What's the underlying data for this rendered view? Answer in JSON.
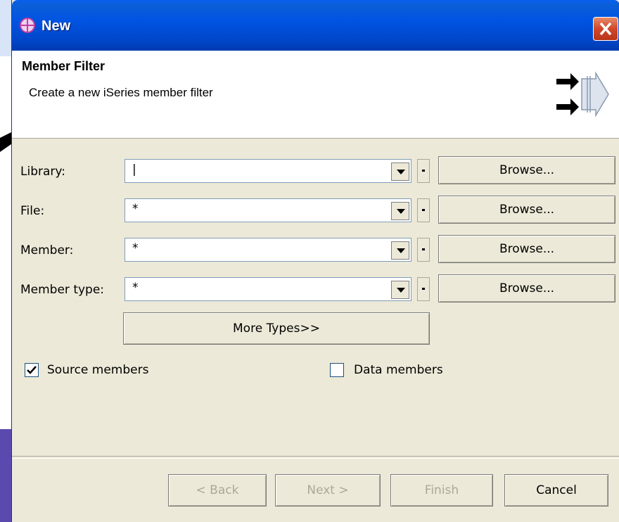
{
  "window": {
    "title": "New"
  },
  "header": {
    "title": "Member Filter",
    "description": "Create a new iSeries member filter"
  },
  "form": {
    "rows": [
      {
        "label": "Library:",
        "value": "|",
        "browse": "Browse..."
      },
      {
        "label": "File:",
        "value": "*",
        "browse": "Browse..."
      },
      {
        "label": "Member:",
        "value": "*",
        "browse": "Browse..."
      },
      {
        "label": "Member type:",
        "value": "*",
        "browse": "Browse..."
      }
    ],
    "more_types": "More Types>>",
    "source_members": {
      "label": "Source members",
      "checked": true
    },
    "data_members": {
      "label": "Data members",
      "checked": false
    }
  },
  "footer": {
    "back": "< Back",
    "next": "Next >",
    "finish": "Finish",
    "cancel": "Cancel"
  },
  "colors": {
    "title_blue": "#0054e3",
    "dialog_bg": "#ece9d8",
    "close_red": "#d0482a"
  },
  "icons": {
    "title": "plus-target-icon",
    "wizard": "wizard-arrows-icon",
    "close": "close-icon"
  }
}
